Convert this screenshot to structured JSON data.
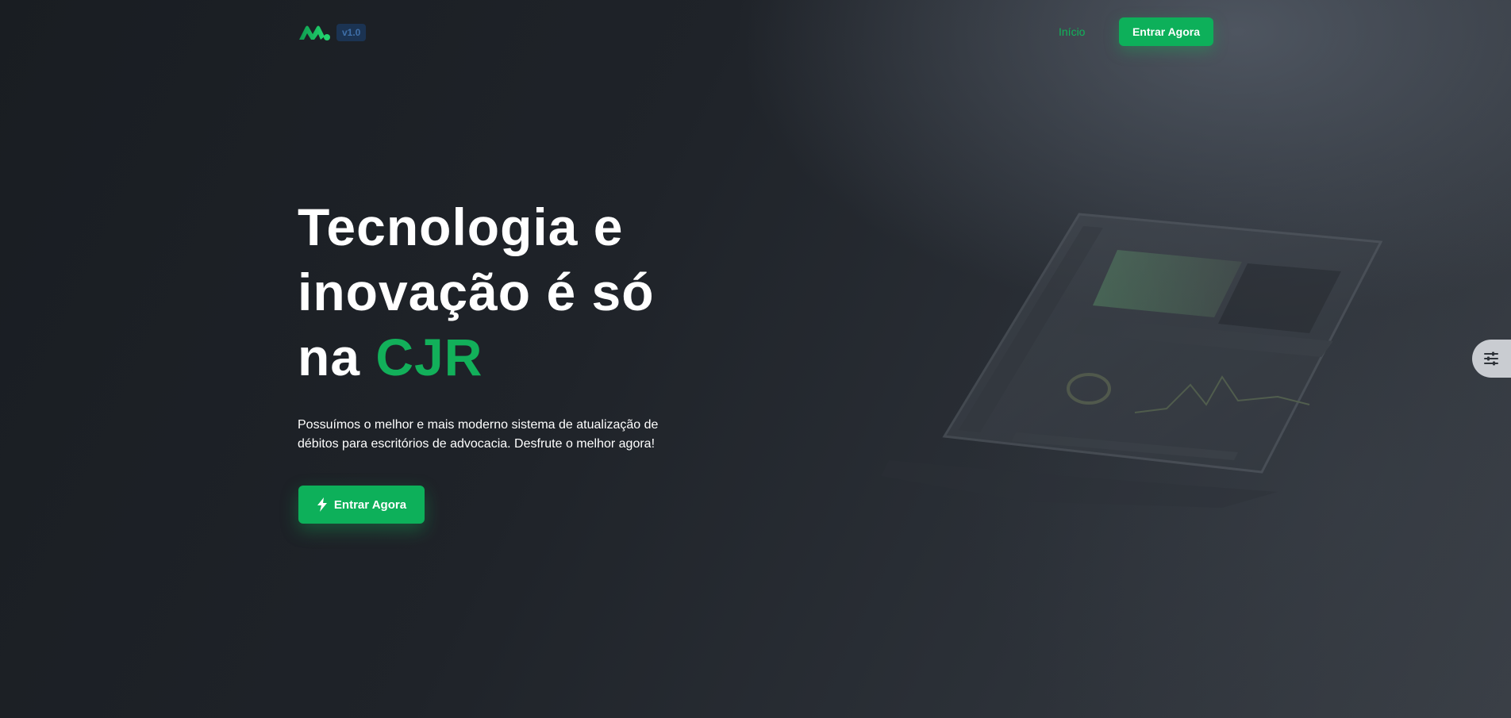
{
  "header": {
    "logo_name": "m-logo-icon",
    "version_badge": "v1.0",
    "nav_link": "Início",
    "nav_button": "Entrar Agora"
  },
  "hero": {
    "title_line1": "Tecnologia e",
    "title_line2": "inovação é só",
    "title_line3_prefix": "na ",
    "title_accent": "CJR",
    "description": "Possuímos o melhor e mais moderno sistema de atualização de débitos para escritórios de advocacia. Desfrute o melhor agora!",
    "cta_button": "Entrar Agora",
    "cta_icon": "bolt-icon"
  },
  "floating": {
    "config_icon": "sliders-icon"
  },
  "colors": {
    "accent": "#0db05a",
    "background": "#1b1f24",
    "badge_bg": "#1b3352",
    "badge_text": "#3f6fa8"
  }
}
